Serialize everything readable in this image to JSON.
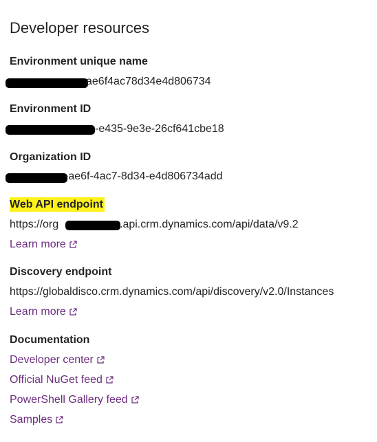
{
  "title": "Developer resources",
  "env_name": {
    "label": "Environment unique name",
    "value_suffix": "ae6f4ac78d34e4d806734"
  },
  "env_id": {
    "label": "Environment ID",
    "value_suffix": "-e435-9e3e-26cf641cbe18"
  },
  "org_id": {
    "label": "Organization ID",
    "value_suffix": "-ae6f-4ac7-8d34-e4d806734add"
  },
  "web_api": {
    "label": "Web API endpoint",
    "value_prefix": "https://org",
    "value_suffix": ".api.crm.dynamics.com/api/data/v9.2",
    "learn_more": "Learn more"
  },
  "discovery": {
    "label": "Discovery endpoint",
    "value": "https://globaldisco.crm.dynamics.com/api/discovery/v2.0/Instances",
    "learn_more": "Learn more"
  },
  "documentation": {
    "label": "Documentation",
    "links": [
      "Developer center",
      "Official NuGet feed",
      "PowerShell Gallery feed",
      "Samples"
    ]
  },
  "colors": {
    "link": "#6b2c7e",
    "highlight": "#fdf21b",
    "redaction": "#000000"
  },
  "icons": {
    "external_link": "external-link-icon"
  }
}
